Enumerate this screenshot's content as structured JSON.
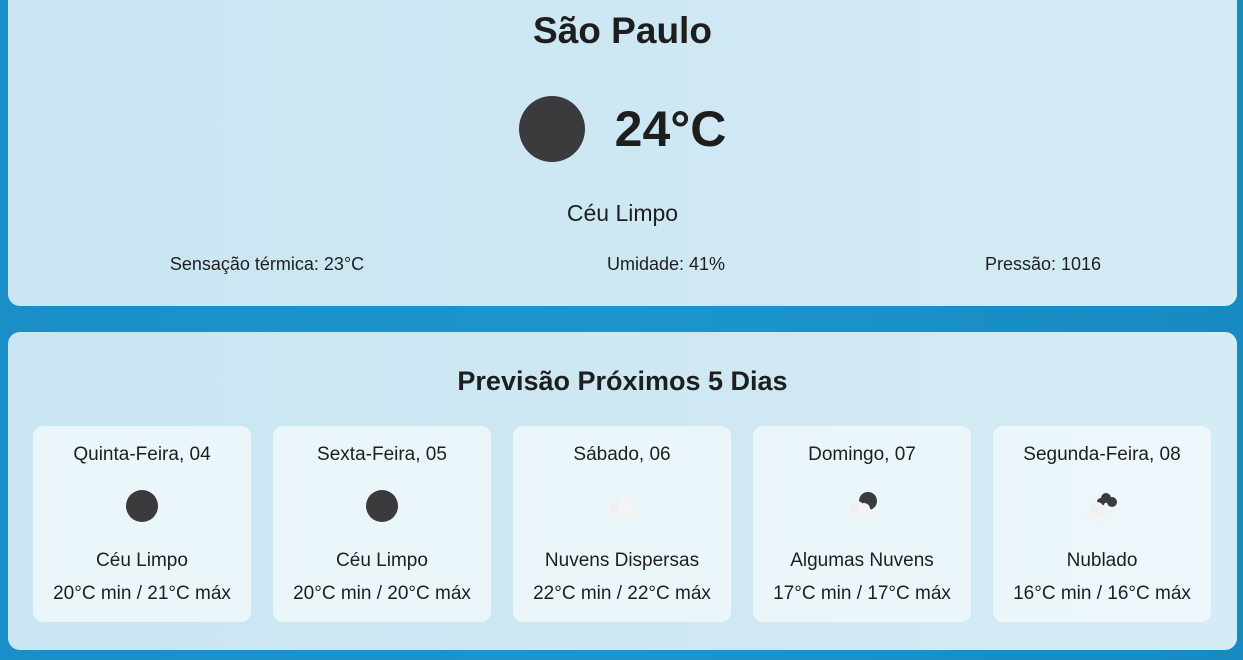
{
  "current": {
    "city": "São Paulo",
    "temperature": "24°C",
    "description": "Céu Limpo",
    "icon": "clear-sun-icon",
    "feels_like": "Sensação térmica: 23°C",
    "humidity": "Umidade: 41%",
    "pressure": "Pressão: 1016"
  },
  "forecast": {
    "title": "Previsão Próximos 5 Dias",
    "days": [
      {
        "name": "Quinta-Feira, 04",
        "icon": "clear-sun-icon",
        "description": "Céu Limpo",
        "temps": "20°C min / 21°C máx"
      },
      {
        "name": "Sexta-Feira, 05",
        "icon": "clear-sun-icon",
        "description": "Céu Limpo",
        "temps": "20°C min / 20°C máx"
      },
      {
        "name": "Sábado, 06",
        "icon": "scattered-clouds-icon",
        "description": "Nuvens Dispersas",
        "temps": "22°C min / 22°C máx"
      },
      {
        "name": "Domingo, 07",
        "icon": "few-clouds-icon",
        "description": "Algumas Nuvens",
        "temps": "17°C min / 17°C máx"
      },
      {
        "name": "Segunda-Feira, 08",
        "icon": "broken-clouds-icon",
        "description": "Nublado",
        "temps": "16°C min / 16°C máx"
      }
    ]
  }
}
